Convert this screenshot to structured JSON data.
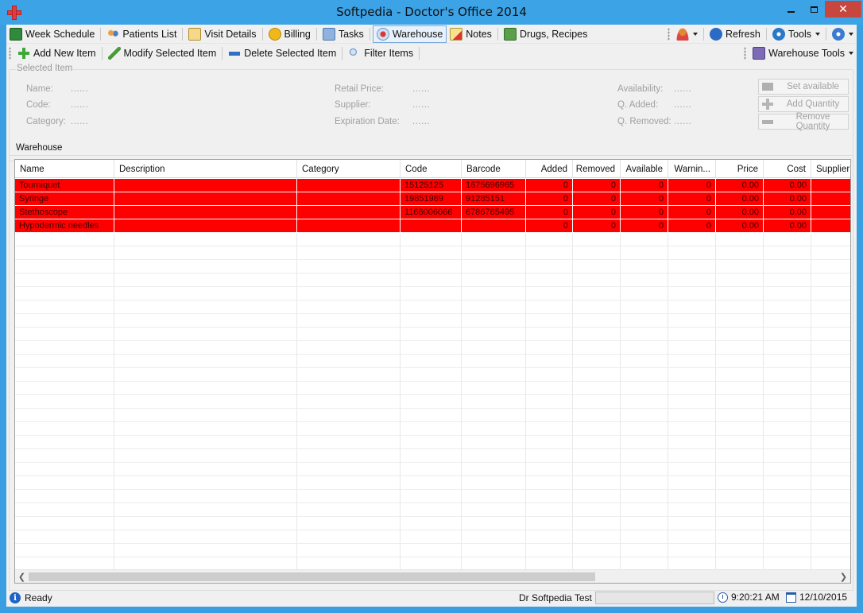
{
  "window": {
    "title": "Softpedia - Doctor's Office 2014"
  },
  "toolbar1": {
    "items": [
      {
        "label": "Week Schedule",
        "icon": "book-icon"
      },
      {
        "label": "Patients List",
        "icon": "patients-icon"
      },
      {
        "label": "Visit Details",
        "icon": "clipboard-icon"
      },
      {
        "label": "Billing",
        "icon": "coin-icon"
      },
      {
        "label": "Tasks",
        "icon": "tasks-icon"
      },
      {
        "label": "Warehouse",
        "icon": "warehouse-icon",
        "active": true
      },
      {
        "label": "Notes",
        "icon": "notes-icon"
      },
      {
        "label": "Drugs, Recipes",
        "icon": "drugs-icon"
      }
    ],
    "refresh_label": "Refresh",
    "tools_label": "Tools"
  },
  "toolbar2": {
    "add_label": "Add New Item",
    "modify_label": "Modify Selected Item",
    "delete_label": "Delete Selected Item",
    "filter_label": "Filter Items",
    "warehouse_tools_label": "Warehouse Tools"
  },
  "selected_item": {
    "legend": "Selected Item",
    "name_label": "Name:",
    "name_value": "......",
    "code_label": "Code:",
    "code_value": "......",
    "category_label": "Category:",
    "category_value": "......",
    "retail_label": "Retail Price:",
    "retail_value": "......",
    "supplier_label": "Supplier:",
    "supplier_value": "......",
    "expiration_label": "Expiration Date:",
    "expiration_value": "......",
    "availability_label": "Availability:",
    "availability_value": "......",
    "qadded_label": "Q. Added:",
    "qadded_value": "......",
    "qremoved_label": "Q. Removed:",
    "qremoved_value": "......",
    "set_available_label": "Set available",
    "add_quantity_label": "Add Quantity",
    "remove_quantity_label": "Remove Quantity"
  },
  "warehouse": {
    "legend": "Warehouse",
    "columns": [
      "Name",
      "Description",
      "Category",
      "Code",
      "Barcode",
      "Added",
      "Removed",
      "Available",
      "Warnin...",
      "Price",
      "Cost",
      "Supplier"
    ],
    "rows": [
      [
        "Tourniquet",
        "",
        "",
        "15125125",
        "1675696965",
        "0",
        "0",
        "0",
        "0",
        "0.00",
        "0.00",
        ""
      ],
      [
        "Syringe",
        "",
        "",
        "19851989",
        "91285151",
        "0",
        "0",
        "0",
        "0",
        "0.00",
        "0.00",
        ""
      ],
      [
        "Stethoscope",
        "",
        "",
        "1168006066",
        "6786785495",
        "0",
        "0",
        "0",
        "0",
        "0.00",
        "0.00",
        ""
      ],
      [
        "Hypodermic needles",
        "",
        "",
        "",
        "",
        "0",
        "0",
        "0",
        "0",
        "0.00",
        "0.00",
        ""
      ]
    ]
  },
  "status": {
    "ready": "Ready",
    "user": "Dr Softpedia Test",
    "time": "9:20:21 AM",
    "date": "12/10/2015"
  },
  "colors": {
    "row_alert": "#ff0000",
    "titlebar": "#3ba3e6"
  }
}
